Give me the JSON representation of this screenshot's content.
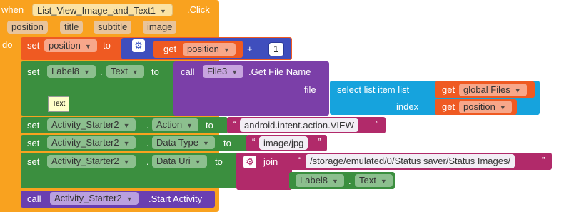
{
  "event": {
    "when_label": "when",
    "component": "List_View_Image_and_Text1",
    "event_name": ".Click",
    "params": [
      "position",
      "title",
      "subtitle",
      "image"
    ],
    "do_label": "do"
  },
  "stmt1": {
    "set_label": "set",
    "variable": "position",
    "to_label": "to",
    "get_label": "get",
    "get_var": "position",
    "op": "+",
    "number": "1"
  },
  "stmt2": {
    "set_label": "set",
    "component": "Label8",
    "dot": ".",
    "property": "Text",
    "to_label": "to",
    "call_label": "call",
    "call_component": "File3",
    "method": ".Get File Name",
    "file_label": "file",
    "select_label": "select list item",
    "list_label": "list",
    "get_label": "get",
    "list_var": "global Files",
    "index_label": "index",
    "index_get_label": "get",
    "index_var": "position",
    "tooltip": "Text"
  },
  "stmt3": {
    "set_label": "set",
    "component": "Activity_Starter2",
    "dot": ".",
    "property": "Action",
    "to_label": "to",
    "value": "android.intent.action.VIEW"
  },
  "stmt4": {
    "set_label": "set",
    "component": "Activity_Starter2",
    "dot": ".",
    "property": "Data Type",
    "to_label": "to",
    "value": "image/jpg"
  },
  "stmt5": {
    "set_label": "set",
    "component": "Activity_Starter2",
    "dot": ".",
    "property": "Data Uri",
    "to_label": "to",
    "join_label": "join",
    "join_text": "/storage/emulated/0/Status saver/Status Images/",
    "comp2": "Label8",
    "dot2": ".",
    "prop2": "Text"
  },
  "stmt6": {
    "call_label": "call",
    "component": "Activity_Starter2",
    "method": ".Start Activity"
  },
  "colors": {
    "event": "#f9a21f",
    "variables": "#ef5a22",
    "math": "#3f4ebd",
    "components": "#3b8f3f",
    "component_dark": "#2f6f31",
    "file": "#7b3fa8",
    "lists": "#16a3dd",
    "text": "#b12a6a",
    "call": "#6a3fb1"
  }
}
